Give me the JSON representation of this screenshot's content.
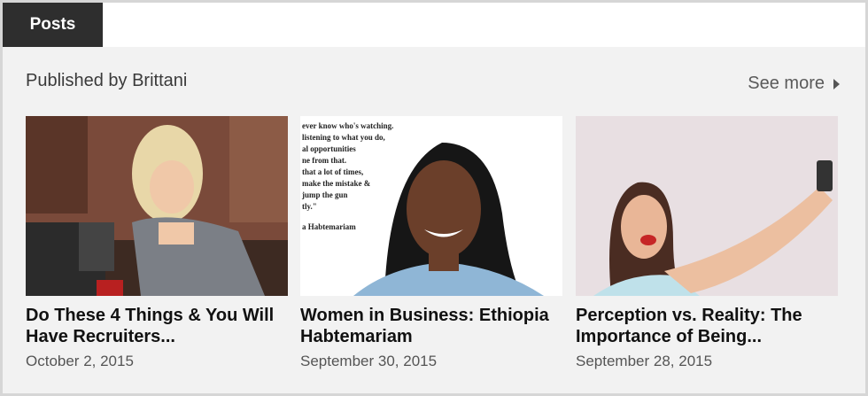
{
  "tabs": {
    "posts_label": "Posts"
  },
  "section": {
    "title": "Published by Brittani",
    "see_more_label": "See more"
  },
  "icons": {
    "see_more": "chevron-right-icon"
  },
  "posts": [
    {
      "title": "Do These 4 Things & You Will Have Recruiters...",
      "date": "October 2, 2015"
    },
    {
      "title": "Women in Business: Ethiopia Habtemariam",
      "date": "September 30, 2015",
      "image_text": [
        "ever know who's watching.",
        "listening to what you do,",
        "al opportunities",
        "ne from that.",
        "that a lot of times,",
        "make the mistake &",
        "jump the gun",
        "tly.\"",
        "a Habtemariam"
      ]
    },
    {
      "title": "Perception vs. Reality: The Importance of Being...",
      "date": "September 28, 2015"
    }
  ],
  "colors": {
    "tab_bg": "#2e2e2e",
    "panel_bg": "#f2f2f2",
    "title": "#111111",
    "muted": "#555555"
  }
}
